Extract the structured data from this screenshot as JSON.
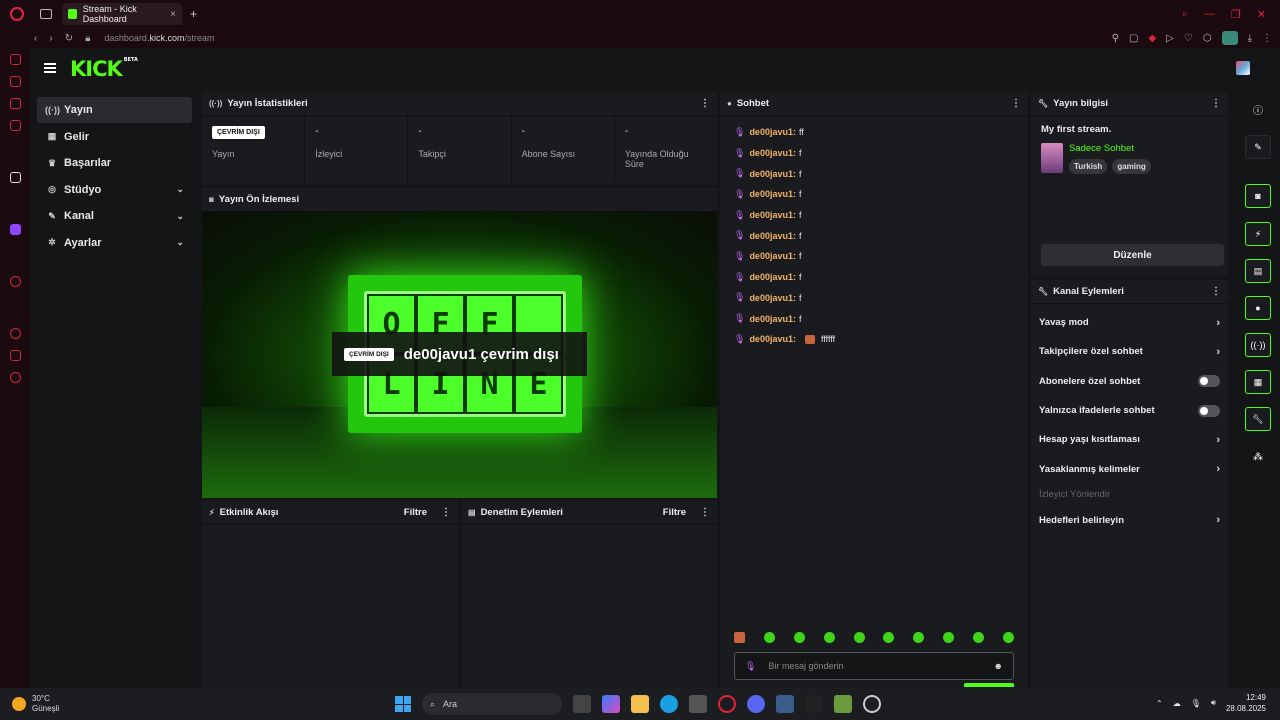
{
  "browser": {
    "tab_title": "Stream - Kick Dashboard",
    "tab_close": "×",
    "new_tab": "+",
    "url_prefix": "dashboard.",
    "url_domain": "kick.com",
    "url_path": "/stream"
  },
  "header": {
    "logo": "KICK",
    "beta": "BETA"
  },
  "sidebar": {
    "items": [
      {
        "label": "Yayın",
        "icon": "broadcast-icon",
        "glyph": "((·))",
        "chevron": ""
      },
      {
        "label": "Gelir",
        "icon": "chart-icon",
        "glyph": "▦",
        "chevron": ""
      },
      {
        "label": "Başarılar",
        "icon": "trophy-icon",
        "glyph": "♛",
        "chevron": ""
      },
      {
        "label": "Stüdyo",
        "icon": "studio-icon",
        "glyph": "◎",
        "chevron": "⌄"
      },
      {
        "label": "Kanal",
        "icon": "channel-icon",
        "glyph": "✎",
        "chevron": "⌄"
      },
      {
        "label": "Ayarlar",
        "icon": "gear-icon",
        "glyph": "✲",
        "chevron": "⌄"
      }
    ]
  },
  "stats": {
    "title": "Yayın İstatistikleri",
    "status_badge": "ÇEVRİM DIŞI",
    "items": [
      {
        "value": "",
        "label": "Yayın"
      },
      {
        "value": "-",
        "label": "İzleyici"
      },
      {
        "value": "-",
        "label": "Takipçi"
      },
      {
        "value": "-",
        "label": "Abone Sayısı"
      },
      {
        "value": "-",
        "label": "Yayında Olduğu Süre"
      }
    ]
  },
  "preview": {
    "title": "Yayın Ön İzlemesi",
    "badge": "ÇEVRİM DIŞI",
    "text": "de00javu1 çevrim dışı",
    "tiles": [
      "O",
      "F",
      "F",
      "",
      "",
      "L",
      "I",
      "N",
      "E"
    ]
  },
  "activity": {
    "title": "Etkinlik Akışı",
    "filter": "Filtre"
  },
  "moderation": {
    "title": "Denetim Eylemleri",
    "filter": "Filtre"
  },
  "chat": {
    "title": "Sohbet",
    "messages": [
      {
        "user": "de00javu1:",
        "text": "ff",
        "emote": false
      },
      {
        "user": "de00javu1:",
        "text": "f",
        "emote": false
      },
      {
        "user": "de00javu1:",
        "text": "f",
        "emote": false
      },
      {
        "user": "de00javu1:",
        "text": "f",
        "emote": false
      },
      {
        "user": "de00javu1:",
        "text": "f",
        "emote": false
      },
      {
        "user": "de00javu1:",
        "text": "f",
        "emote": false
      },
      {
        "user": "de00javu1:",
        "text": "f",
        "emote": false
      },
      {
        "user": "de00javu1:",
        "text": "f",
        "emote": false
      },
      {
        "user": "de00javu1:",
        "text": "f",
        "emote": false
      },
      {
        "user": "de00javu1:",
        "text": "f",
        "emote": false
      },
      {
        "user": "de00javu1:",
        "text": "ffffff",
        "emote": true
      }
    ],
    "input_placeholder": "Bir mesaj gönderin"
  },
  "stream_info": {
    "title": "Yayın bilgisi",
    "stream_title": "My first stream.",
    "category": "Sadece Sohbet",
    "tags": [
      "Turkish",
      "gaming"
    ],
    "edit": "Düzenle"
  },
  "channel_actions": {
    "title": "Kanal Eylemleri",
    "items": [
      {
        "label": "Yavaş mod",
        "control": "chevron"
      },
      {
        "label": "Takipçilere özel sohbet",
        "control": "chevron"
      },
      {
        "label": "Abonelere özel sohbet",
        "control": "toggle"
      },
      {
        "label": "Yalnızca ifadelerle sohbet",
        "control": "toggle"
      },
      {
        "label": "Hesap yaşı kısıtlaması",
        "control": "chevron"
      },
      {
        "label": "Yasaklanmış kelimeler",
        "control": "chevron"
      },
      {
        "label": "İzleyici Yönlendir",
        "control": "none"
      },
      {
        "label": "Hedefleri belirleyin",
        "control": "chevron"
      }
    ]
  },
  "taskbar": {
    "temp": "30°C",
    "weather": "Güneşli",
    "search": "Ara",
    "time": "12:49",
    "date": "28.08.2025"
  },
  "colors": {
    "accent": "#53fc18",
    "brand_red": "#e0243a",
    "username": "#f2b26b"
  }
}
